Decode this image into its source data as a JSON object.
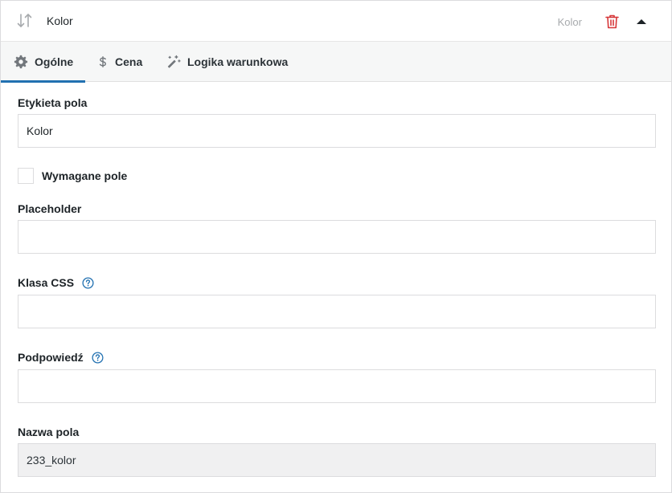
{
  "header": {
    "title": "Kolor",
    "type_label": "Kolor",
    "icons": {
      "sort": "sort-arrows-icon",
      "delete": "trash-icon",
      "toggle": "caret-up-icon"
    },
    "colors": {
      "delete": "#d63638"
    }
  },
  "tabs": [
    {
      "label": "Ogólne",
      "icon": "gear-icon",
      "active": true
    },
    {
      "label": "Cena",
      "icon": "dollar-icon",
      "active": false
    },
    {
      "label": "Logika warunkowa",
      "icon": "magic-wand-icon",
      "active": false
    }
  ],
  "accent_color": "#2271b1",
  "form": {
    "field_label": {
      "label": "Etykieta pola",
      "value": "Kolor"
    },
    "required": {
      "label": "Wymagane pole",
      "checked": false
    },
    "placeholder": {
      "label": "Placeholder",
      "value": ""
    },
    "css_class": {
      "label": "Klasa CSS",
      "value": ""
    },
    "hint": {
      "label": "Podpowiedź",
      "value": ""
    },
    "field_name": {
      "label": "Nazwa pola",
      "value": "233_kolor"
    }
  }
}
